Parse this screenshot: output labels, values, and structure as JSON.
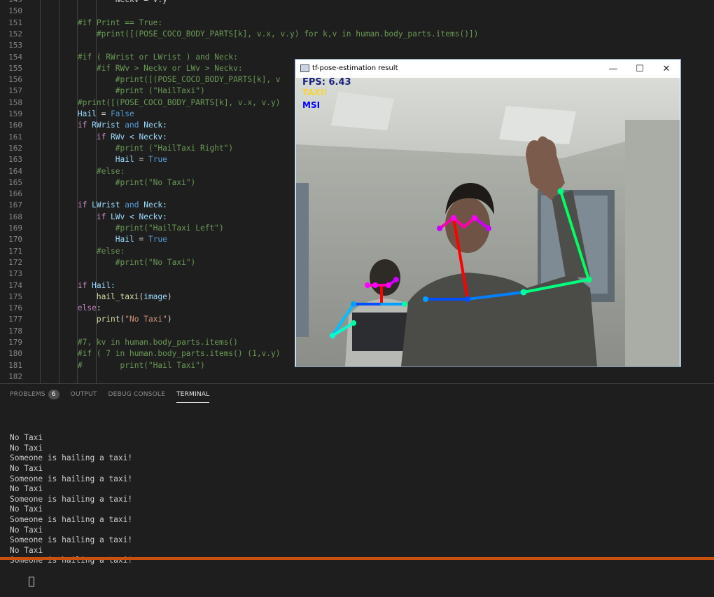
{
  "editor": {
    "lines": [
      {
        "n": "149",
        "segs": [
          [
            "                ",
            ""
          ],
          [
            "Neckv = v.y",
            ""
          ]
        ]
      },
      {
        "n": "150",
        "segs": []
      },
      {
        "n": "151",
        "segs": [
          [
            "        ",
            ""
          ],
          [
            "#if Print == True:",
            "c-com"
          ]
        ]
      },
      {
        "n": "152",
        "segs": [
          [
            "            ",
            ""
          ],
          [
            "#print([(POSE_COCO_BODY_PARTS[k], v.x, v.y) for k,v in human.body_parts.items()])",
            "c-com"
          ]
        ]
      },
      {
        "n": "153",
        "segs": []
      },
      {
        "n": "154",
        "segs": [
          [
            "        ",
            ""
          ],
          [
            "#if ( RWrist or LWrist ) and Neck:",
            "c-com"
          ]
        ]
      },
      {
        "n": "155",
        "segs": [
          [
            "            ",
            ""
          ],
          [
            "#if RWv > Neckv or LWv > Neckv:",
            "c-com"
          ]
        ]
      },
      {
        "n": "156",
        "segs": [
          [
            "                ",
            ""
          ],
          [
            "#print([(POSE_COCO_BODY_PARTS[k], v",
            "c-com"
          ]
        ]
      },
      {
        "n": "157",
        "segs": [
          [
            "                ",
            ""
          ],
          [
            "#print (\"HailTaxi\")",
            "c-com"
          ]
        ]
      },
      {
        "n": "158",
        "segs": [
          [
            "        ",
            ""
          ],
          [
            "#print([(POSE_COCO_BODY_PARTS[k], v.x, v.y)",
            "c-com"
          ]
        ]
      },
      {
        "n": "159",
        "segs": [
          [
            "        ",
            ""
          ],
          [
            "Hail",
            "c-var"
          ],
          [
            " = ",
            ""
          ],
          [
            "False",
            "c-kw"
          ]
        ]
      },
      {
        "n": "160",
        "segs": [
          [
            "        ",
            ""
          ],
          [
            "if",
            "c-ctl"
          ],
          [
            " RWrist ",
            "c-var"
          ],
          [
            "and",
            "c-kw"
          ],
          [
            " Neck:",
            "c-var"
          ]
        ]
      },
      {
        "n": "161",
        "segs": [
          [
            "            ",
            ""
          ],
          [
            "if",
            "c-ctl"
          ],
          [
            " RWv < Neckv:",
            "c-var"
          ]
        ]
      },
      {
        "n": "162",
        "segs": [
          [
            "                ",
            ""
          ],
          [
            "#print (\"HailTaxi Right\")",
            "c-com"
          ]
        ]
      },
      {
        "n": "163",
        "segs": [
          [
            "                ",
            ""
          ],
          [
            "Hail",
            "c-var"
          ],
          [
            " = ",
            ""
          ],
          [
            "True",
            "c-kw"
          ]
        ]
      },
      {
        "n": "164",
        "segs": [
          [
            "            ",
            ""
          ],
          [
            "#else:",
            "c-com"
          ]
        ]
      },
      {
        "n": "165",
        "segs": [
          [
            "                ",
            ""
          ],
          [
            "#print(\"No Taxi\")",
            "c-com"
          ]
        ]
      },
      {
        "n": "166",
        "segs": []
      },
      {
        "n": "167",
        "segs": [
          [
            "        ",
            ""
          ],
          [
            "if",
            "c-ctl"
          ],
          [
            " LWrist ",
            "c-var"
          ],
          [
            "and",
            "c-kw"
          ],
          [
            " Neck:",
            "c-var"
          ]
        ]
      },
      {
        "n": "168",
        "segs": [
          [
            "            ",
            ""
          ],
          [
            "if",
            "c-ctl"
          ],
          [
            " LWv < Neckv:",
            "c-var"
          ]
        ]
      },
      {
        "n": "169",
        "segs": [
          [
            "                ",
            ""
          ],
          [
            "#print(\"HailTaxi Left\")",
            "c-com"
          ]
        ]
      },
      {
        "n": "170",
        "segs": [
          [
            "                ",
            ""
          ],
          [
            "Hail",
            "c-var"
          ],
          [
            " = ",
            ""
          ],
          [
            "True",
            "c-kw"
          ]
        ]
      },
      {
        "n": "171",
        "segs": [
          [
            "            ",
            ""
          ],
          [
            "#else:",
            "c-com"
          ]
        ]
      },
      {
        "n": "172",
        "segs": [
          [
            "                ",
            ""
          ],
          [
            "#print(\"No Taxi\")",
            "c-com"
          ]
        ]
      },
      {
        "n": "173",
        "segs": []
      },
      {
        "n": "174",
        "segs": [
          [
            "        ",
            ""
          ],
          [
            "if",
            "c-ctl"
          ],
          [
            " Hail:",
            "c-var"
          ]
        ]
      },
      {
        "n": "175",
        "segs": [
          [
            "            ",
            ""
          ],
          [
            "hail_taxi",
            "c-fn"
          ],
          [
            "(",
            ""
          ],
          [
            "image",
            "c-var"
          ],
          [
            ")",
            ""
          ]
        ]
      },
      {
        "n": "176",
        "segs": [
          [
            "        ",
            ""
          ],
          [
            "else",
            "c-ctl"
          ],
          [
            ":",
            ""
          ]
        ]
      },
      {
        "n": "177",
        "segs": [
          [
            "            ",
            ""
          ],
          [
            "print",
            "c-fn"
          ],
          [
            "(",
            ""
          ],
          [
            "\"No Taxi\"",
            "c-str"
          ],
          [
            ")",
            ""
          ]
        ]
      },
      {
        "n": "178",
        "segs": []
      },
      {
        "n": "179",
        "segs": [
          [
            "        ",
            ""
          ],
          [
            "#7, kv in human.body_parts.items()",
            "c-com"
          ]
        ]
      },
      {
        "n": "180",
        "segs": [
          [
            "        ",
            ""
          ],
          [
            "#if ( 7 in human.body_parts.items() (1,v.y)",
            "c-com"
          ]
        ]
      },
      {
        "n": "181",
        "segs": [
          [
            "        ",
            ""
          ],
          [
            "#        print(\"Hail Taxi\")",
            "c-com"
          ]
        ]
      },
      {
        "n": "182",
        "segs": []
      }
    ]
  },
  "panel": {
    "tabs": [
      {
        "label": "PROBLEMS",
        "badge": "6",
        "active": false
      },
      {
        "label": "OUTPUT",
        "active": false
      },
      {
        "label": "DEBUG CONSOLE",
        "active": false
      },
      {
        "label": "TERMINAL",
        "active": true
      }
    ],
    "terminal_lines": [
      "No Taxi",
      "No Taxi",
      "Someone is hailing a taxi!",
      "No Taxi",
      "Someone is hailing a taxi!",
      "No Taxi",
      "Someone is hailing a taxi!",
      "No Taxi",
      "Someone is hailing a taxi!",
      "No Taxi",
      "Someone is hailing a taxi!",
      "No Taxi",
      "Someone is hailing a taxi!"
    ]
  },
  "window": {
    "title": "tf-pose-estimation result",
    "minimize_glyph": "—",
    "maximize_glyph": "☐",
    "close_glyph": "✕",
    "overlay": {
      "fps": "FPS: 6.43",
      "taxi": "TAXI!",
      "msi": "MSI",
      "fps_color": "#1a237e",
      "taxi_color": "#f5d33a",
      "msi_color": "#0000ff"
    }
  },
  "colors": {
    "statusbar": "#ca5010",
    "keyword": "#569cd6",
    "comment": "#6a9955"
  }
}
